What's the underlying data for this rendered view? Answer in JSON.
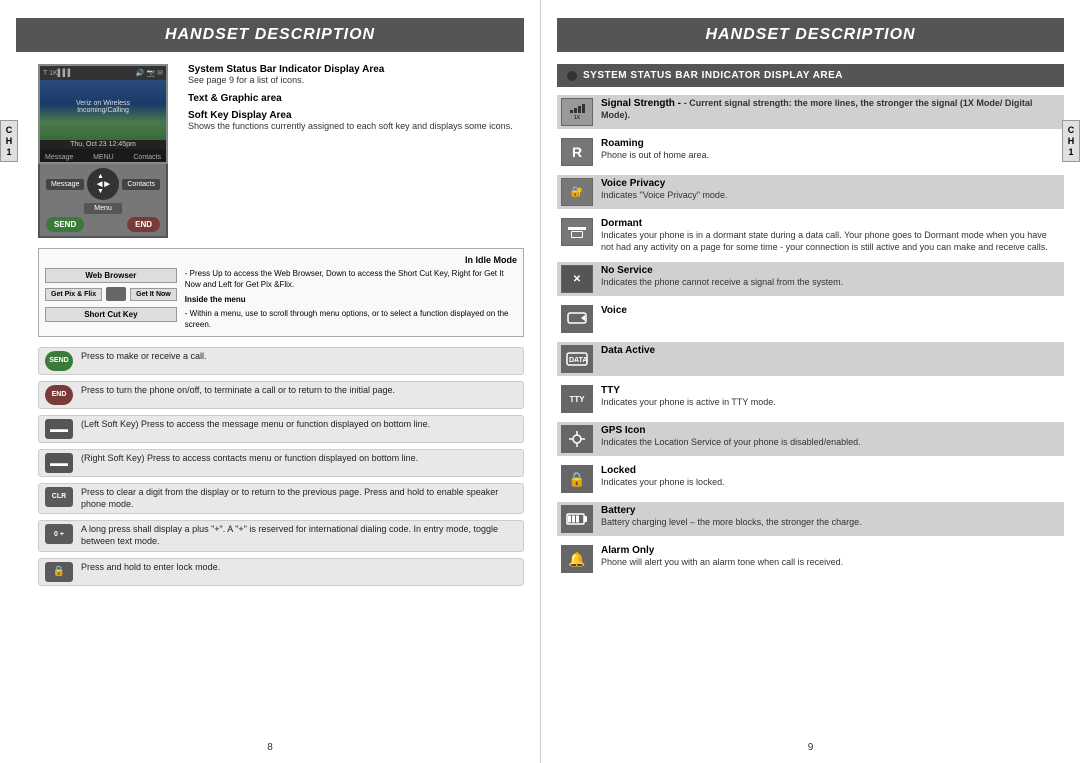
{
  "left_page": {
    "title": "HANDSET DESCRIPTION",
    "ch_tab": "C\nH\n1",
    "system_status_label": "System Status Bar Indicator Display Area",
    "system_status_note": "See page 9 for a list of icons.",
    "text_graphic_label": "Text & Graphic area",
    "soft_key_label": "Soft Key Display Area",
    "soft_key_desc": "Shows the functions currently assigned to each soft key and displays some icons.",
    "softkeys": {
      "message": "Message",
      "menu": "Menu",
      "contacts": "Contacts"
    },
    "idle_mode": {
      "header": "In Idle Mode",
      "web_browser": "Web Browser",
      "get_pix_flix": "Get Pix & Flix",
      "get_it_now": "Get It Now",
      "short_cut_key": "Short Cut Key",
      "inside_menu": "Inside the menu",
      "desc1": "- Press Up to access the Web Browser, Down to access the Short Cut Key, Right for Get It Now and Left for Get Pix &Flix.",
      "desc2": "- Within a menu, use to scroll through menu options, or to select a function displayed on the screen."
    },
    "button_rows": [
      {
        "icon": "SEND",
        "desc": "Press to make or receive a call."
      },
      {
        "icon": "END",
        "desc": "Press to turn the phone on/off, to terminate a call or to return to the initial page."
      },
      {
        "icon": "...",
        "desc": "(Left Soft Key) Press to access the message menu or function displayed on bottom line."
      },
      {
        "icon": "...",
        "desc": "(Right Soft Key) Press to access contacts menu or function displayed on bottom line."
      },
      {
        "icon": "CLR",
        "desc": "Press to clear a digit from the display or to return to the previous page.\nPress and hold to enable speaker phone mode."
      },
      {
        "icon": "0+",
        "desc": "A long press shall display a plus \"+\".\nA \"+\" is reserved for international dialing code.\nIn entry mode, toggle between text mode."
      },
      {
        "icon": "LOCK",
        "desc": "Press and hold to enter lock mode."
      }
    ],
    "page_number": "8"
  },
  "right_page": {
    "title": "HANDSET DESCRIPTION",
    "ch_tab": "C\nH\n1",
    "system_status_header": "SYSTEM STATUS BAR INDICATOR DISPLAY AREA",
    "status_items": [
      {
        "id": "signal",
        "shaded": true,
        "icon_type": "signal",
        "title": "Signal Strength",
        "desc": "- Current signal strength: the more lines, the stronger the signal (1X Mode/ Digital Mode)."
      },
      {
        "id": "roaming",
        "shaded": false,
        "icon_type": "roaming",
        "title": "Roaming",
        "desc": "Phone is out of home area."
      },
      {
        "id": "voice-privacy",
        "shaded": true,
        "icon_type": "voice-privacy",
        "title": "Voice Privacy",
        "desc": "Indicates \"Voice Privacy\" mode."
      },
      {
        "id": "dormant",
        "shaded": false,
        "icon_type": "dormant",
        "title": "Dormant",
        "desc": "Indicates your phone is in a dormant state during a data call. Your phone goes to Dormant mode when you have not had any activity on a page for some time - your connection is still active and you can make and receive calls."
      },
      {
        "id": "no-service",
        "shaded": true,
        "icon_type": "no-service",
        "title": "No Service",
        "desc": "Indicates the phone cannot receive a signal from the system."
      },
      {
        "id": "voice",
        "shaded": false,
        "icon_type": "voice",
        "title": "Voice",
        "desc": ""
      },
      {
        "id": "data-active",
        "shaded": true,
        "icon_type": "data-active",
        "title": "Data Active",
        "desc": ""
      },
      {
        "id": "tty",
        "shaded": false,
        "icon_type": "tty",
        "title": "TTY",
        "desc": "Indicates your phone is active in TTY mode."
      },
      {
        "id": "gps",
        "shaded": true,
        "icon_type": "gps",
        "title": "GPS Icon",
        "desc": "Indicates the Location Service of your phone is disabled/enabled."
      },
      {
        "id": "locked",
        "shaded": false,
        "icon_type": "locked",
        "title": "Locked",
        "desc": "Indicates your phone is locked."
      },
      {
        "id": "battery",
        "shaded": true,
        "icon_type": "battery",
        "title": "Battery",
        "desc": "Battery charging level – the more blocks, the stronger the charge."
      },
      {
        "id": "alarm",
        "shaded": false,
        "icon_type": "alarm",
        "title": "Alarm Only",
        "desc": "Phone will alert you with an alarm tone when call is received."
      }
    ],
    "page_number": "9"
  }
}
